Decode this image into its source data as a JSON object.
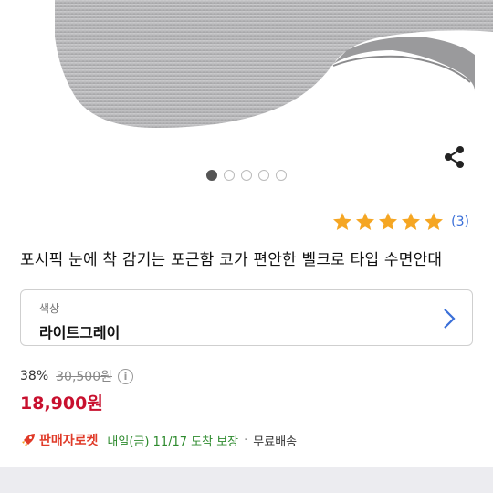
{
  "product": {
    "title": "포시픽 눈에 착 감기는 포근함 코가 편안한 벨크로 타입 수면안대",
    "image_dots": 5,
    "active_dot": 0
  },
  "rating": {
    "stars": 5,
    "count_label": "(3)"
  },
  "option": {
    "label": "색상",
    "value": "라이트그레이"
  },
  "price": {
    "discount": "38%",
    "original": "30,500원",
    "sale": "18,900원"
  },
  "delivery": {
    "badge": "판매자로켓",
    "text": "내일(금) 11/17 도착 보장",
    "separator": "·",
    "shipping": "무료배송"
  },
  "icons": {
    "share": "share-icon",
    "chevron": "chevron-right-icon",
    "info": "info-icon",
    "rocket": "rocket-icon"
  },
  "colors": {
    "sale_price": "#c8102e",
    "star": "#f5a623",
    "rocket": "#e03a28",
    "delivery_text": "#2d8a2d",
    "rating_count": "#3a6fd8"
  }
}
